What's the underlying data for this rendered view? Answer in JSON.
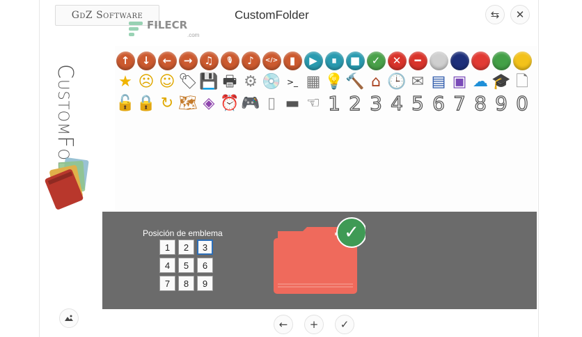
{
  "header": {
    "brand": "GdZ Software",
    "title": "CustomFolder",
    "watermark": "FILECR",
    "watermark_sub": ".com",
    "swap_icon": "⇆",
    "close_icon": "✕"
  },
  "sidebar": {
    "vertical_title": "CustomFolder"
  },
  "icons": {
    "row1": [
      {
        "name": "arrow-up-icon",
        "glyph": "↑",
        "color": "#cc5a2f"
      },
      {
        "name": "arrow-down-icon",
        "glyph": "↓",
        "color": "#cc5a2f"
      },
      {
        "name": "arrow-left-icon",
        "glyph": "←",
        "color": "#cc5a2f"
      },
      {
        "name": "arrow-right-icon",
        "glyph": "→",
        "color": "#cc5a2f"
      },
      {
        "name": "music-icon",
        "glyph": "♫",
        "color": "#cc5a2f"
      },
      {
        "name": "microphone-icon",
        "glyph": "🎙",
        "color": "#cc5a2f"
      },
      {
        "name": "note-icon",
        "glyph": "♪",
        "color": "#cc5a2f"
      },
      {
        "name": "code-icon",
        "glyph": "</>",
        "color": "#cc5a2f"
      },
      {
        "name": "video-icon",
        "glyph": "▮",
        "color": "#cc5a2f"
      },
      {
        "name": "play-icon",
        "glyph": "▶",
        "color": "#2a9bb0"
      },
      {
        "name": "pause-icon",
        "glyph": "⏸",
        "color": "#2a9bb0"
      },
      {
        "name": "stop-icon",
        "glyph": "■",
        "color": "#2a9bb0"
      },
      {
        "name": "check-icon",
        "glyph": "✓",
        "color": "#4aa14a"
      },
      {
        "name": "cancel-icon",
        "glyph": "✕",
        "color": "#d9342b"
      },
      {
        "name": "minus-icon",
        "glyph": "━",
        "color": "#d9342b"
      },
      {
        "name": "gray-dot-icon",
        "glyph": "",
        "color": "#cfcfcf"
      },
      {
        "name": "navy-dot-icon",
        "glyph": "",
        "color": "#1d2f7a"
      },
      {
        "name": "red-dot-icon",
        "glyph": "",
        "color": "#e23a33"
      },
      {
        "name": "green-dot-icon",
        "glyph": "",
        "color": "#43a047"
      },
      {
        "name": "yellow-dot-icon",
        "glyph": "",
        "color": "#f3c21a"
      }
    ],
    "row2": [
      {
        "name": "star-icon",
        "glyph": "★",
        "color": "#f0b400"
      },
      {
        "name": "sad-face-icon",
        "glyph": "☹",
        "color": "#e0a800"
      },
      {
        "name": "smile-face-icon",
        "glyph": "☺",
        "color": "#e0a800"
      },
      {
        "name": "tag-icon",
        "glyph": "🏷",
        "color": "#555555"
      },
      {
        "name": "save-icon",
        "glyph": "💾",
        "color": "#333333"
      },
      {
        "name": "printer-icon",
        "glyph": "🖶",
        "color": "#444444"
      },
      {
        "name": "settings-icon",
        "glyph": "⚙",
        "color": "#888888"
      },
      {
        "name": "disc-icon",
        "glyph": "💿",
        "color": "#aaaaaa"
      },
      {
        "name": "terminal-icon",
        "glyph": ">_",
        "color": "#222222"
      },
      {
        "name": "calculator-icon",
        "glyph": "▦",
        "color": "#777777"
      },
      {
        "name": "lightbulb-icon",
        "glyph": "💡",
        "color": "#888888"
      },
      {
        "name": "hammer-icon",
        "glyph": "🔨",
        "color": "#8a5a2b"
      },
      {
        "name": "house-icon",
        "glyph": "⌂",
        "color": "#aa4422"
      },
      {
        "name": "clock-icon",
        "glyph": "🕒",
        "color": "#777777"
      },
      {
        "name": "mail-icon",
        "glyph": "✉",
        "color": "#777777"
      },
      {
        "name": "database-icon",
        "glyph": "▤",
        "color": "#2855a8"
      },
      {
        "name": "picture-icon",
        "glyph": "▣",
        "color": "#7a4ab8"
      },
      {
        "name": "cloud-icon",
        "glyph": "☁",
        "color": "#1e8fd8"
      },
      {
        "name": "graduation-icon",
        "glyph": "🎓",
        "color": "#222222"
      },
      {
        "name": "document-icon",
        "glyph": "🗋",
        "color": "#777777"
      }
    ],
    "row3": [
      {
        "name": "unlock-icon",
        "glyph": "🔓",
        "color": "#e0a800"
      },
      {
        "name": "lock-icon",
        "glyph": "🔒",
        "color": "#e0a800"
      },
      {
        "name": "refresh-icon",
        "glyph": "↻",
        "color": "#e0a800"
      },
      {
        "name": "map-icon",
        "glyph": "🗺",
        "color": "#c47a2a"
      },
      {
        "name": "layers-icon",
        "glyph": "◈",
        "color": "#8e44ad"
      },
      {
        "name": "alarm-icon",
        "glyph": "⏰",
        "color": "#d9342b"
      },
      {
        "name": "gamepad-icon",
        "glyph": "🎮",
        "color": "#777777"
      },
      {
        "name": "page-icon",
        "glyph": "▯",
        "color": "#999999"
      },
      {
        "name": "dash-icon",
        "glyph": "▬",
        "color": "#555555"
      },
      {
        "name": "hand-icon",
        "glyph": "☜",
        "color": "#333333"
      }
    ],
    "numbers": [
      "1",
      "2",
      "3",
      "4",
      "5",
      "6",
      "7",
      "8",
      "9",
      "0"
    ]
  },
  "emblem_position": {
    "label": "Posición de emblema",
    "options": [
      "1",
      "2",
      "3",
      "4",
      "5",
      "6",
      "7",
      "8",
      "9"
    ],
    "selected": "3"
  },
  "preview": {
    "folder_color": "#ef6a5c",
    "emblem_color": "#3f9a55",
    "emblem_glyph": "✓"
  },
  "footer": {
    "back_icon": "←",
    "add_icon": "+",
    "apply_icon": "✓"
  }
}
